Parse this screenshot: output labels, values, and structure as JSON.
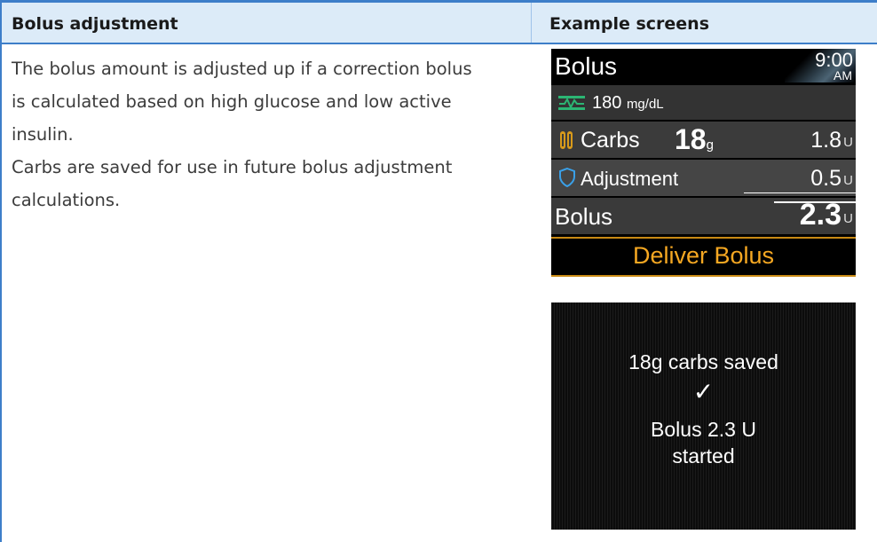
{
  "table": {
    "header_left": "Bolus adjustment",
    "header_right": "Example screens",
    "body_lines": [
      "The bolus amount is adjusted up if a correction bolus",
      "is calculated based on high glucose and low active",
      "insulin.",
      "Carbs are saved for use in future bolus adjustment",
      "calculations."
    ]
  },
  "screen1": {
    "title": "Bolus",
    "time": "9:00",
    "ampm": "AM",
    "glucose_value": "180",
    "glucose_unit": "mg/dL",
    "carbs_label": "Carbs",
    "carbs_amount": "18",
    "carbs_unit": "g",
    "carbs_insulin": "1.8",
    "adjustment_label": "Adjustment",
    "adjustment_insulin": "0.5",
    "bolus_label": "Bolus",
    "bolus_total": "2.3",
    "unit_u": "U",
    "deliver_label": "Deliver Bolus",
    "icons": [
      "glucose-trend-icon",
      "carbs-icon",
      "shield-icon"
    ],
    "colors": {
      "accent": "#f6a822",
      "trend_icon": "#2bb673",
      "shield_icon": "#3aa0e8"
    }
  },
  "screen2": {
    "line1": "18g carbs saved",
    "check": "✓",
    "line2": "Bolus 2.3 U",
    "line3": "started"
  }
}
